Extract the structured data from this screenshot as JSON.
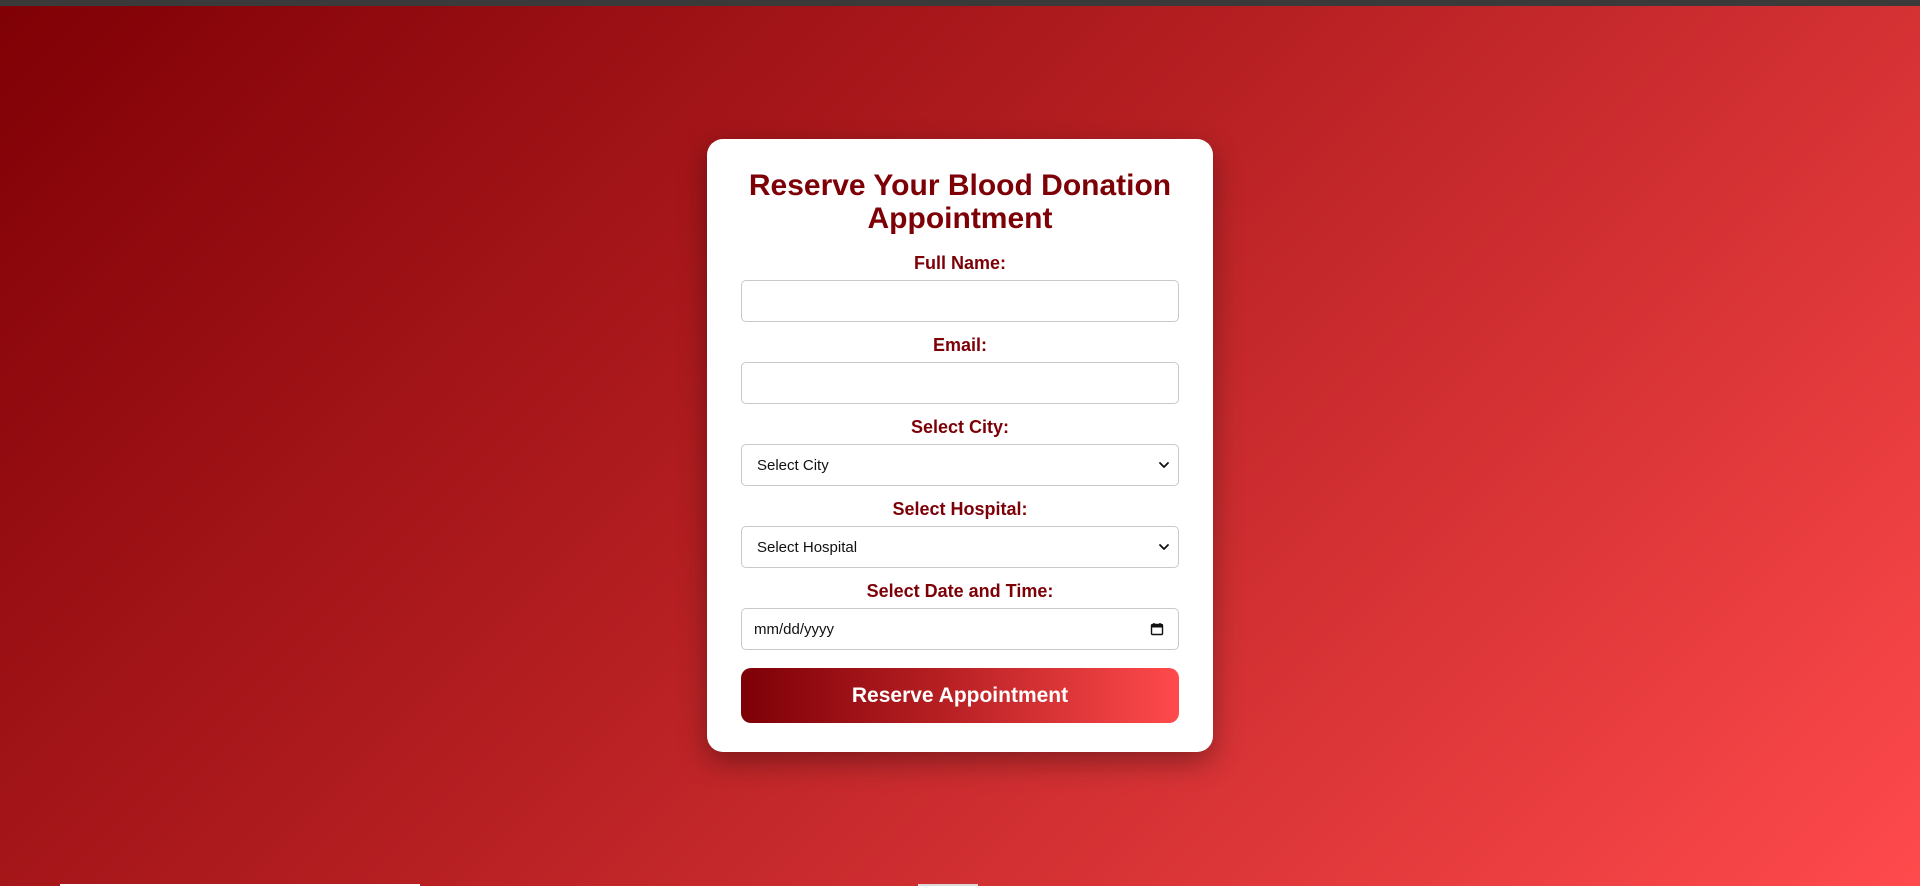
{
  "form": {
    "title": "Reserve Your Blood Donation Appointment",
    "full_name_label": "Full Name:",
    "full_name_value": "",
    "email_label": "Email:",
    "email_value": "",
    "city_label": "Select City:",
    "city_selected": "Select City",
    "hospital_label": "Select Hospital:",
    "hospital_selected": "Select Hospital",
    "datetime_label": "Select Date and Time:",
    "datetime_placeholder": "mm/dd/yyyy",
    "submit_label": "Reserve Appointment"
  },
  "icons": {
    "select_arrow": "chevron-down-icon",
    "date_picker": "calendar-icon"
  },
  "colors": {
    "accent": "#7d0007",
    "background_start": "#7f0005",
    "background_end": "#ff4a4c",
    "card": "#ffffff"
  }
}
